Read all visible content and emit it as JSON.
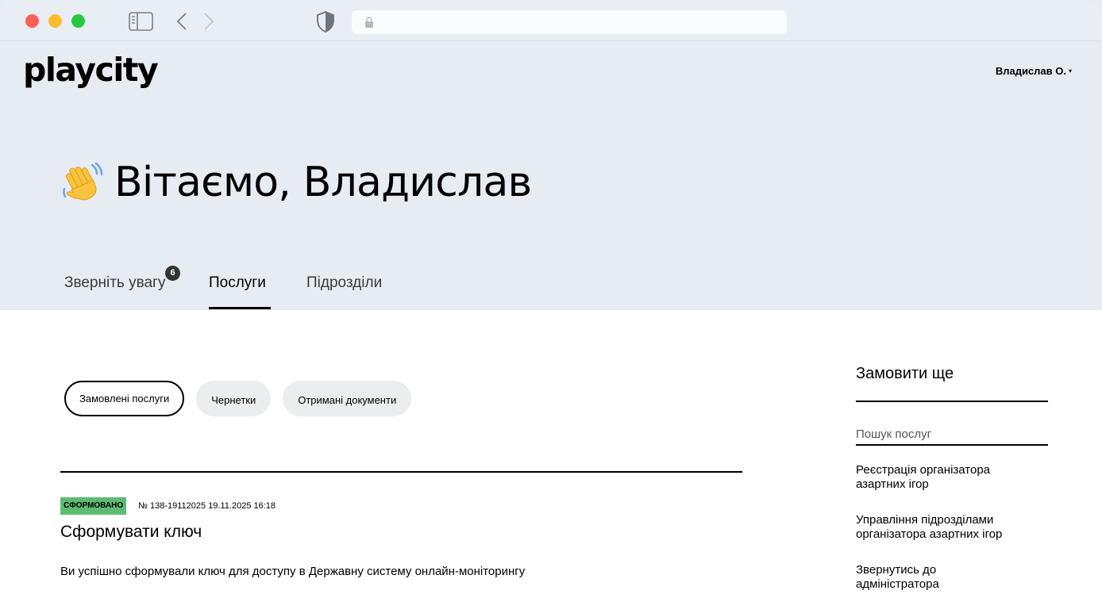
{
  "colors": {
    "hero_bg": "#e7ebf2",
    "status_green": "#5dbb73",
    "badge_dark": "#333333"
  },
  "header": {
    "logo": "playcity",
    "user_name": "Владислав О."
  },
  "hero": {
    "greeting": "Вітаємо, Владислав",
    "greeting_icon": "waving-hand-icon"
  },
  "tabs": [
    {
      "label": "Зверніть увагу",
      "badge": "6",
      "active": false
    },
    {
      "label": "Послуги",
      "active": true
    },
    {
      "label": "Підрозділи",
      "active": false
    }
  ],
  "filters": [
    {
      "label": "Замовлені послуги",
      "active": true
    },
    {
      "label": "Чернетки",
      "active": false
    },
    {
      "label": "Отримані документи",
      "active": false
    }
  ],
  "order": {
    "status": "СФОРМОВАНО",
    "meta": "№ 138-19112025 19.11.2025 16:18",
    "title": "Сформувати ключ",
    "description": "Ви успішно сформували ключ для доступу в Державну систему онлайн-моніторингу"
  },
  "sidebar": {
    "title": "Замовити ще",
    "search_placeholder": "Пошук послуг",
    "links": [
      {
        "line1": "Реєстрація організатора",
        "line2": "азартних ігор"
      },
      {
        "line1": "Управління підрозділами",
        "line2": "організатора азартних ігор"
      },
      {
        "line1": "Звернутись до",
        "line2": "адміністратора"
      }
    ]
  }
}
